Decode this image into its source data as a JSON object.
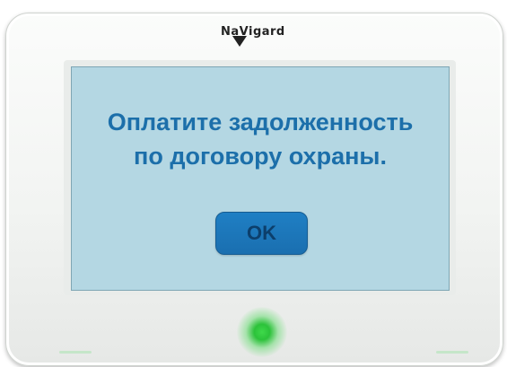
{
  "device": {
    "brand_logo": "NaVigard"
  },
  "dialog": {
    "message_line1": "Оплатите задолженность",
    "message_line2": "по договору охраны.",
    "ok_label": "OK"
  },
  "colors": {
    "screen_background": "#b4d7e3",
    "message_text": "#1c6faa",
    "button_fill": "#1f7fc4",
    "button_text": "#0c3f6c",
    "status_led": "#3ed94a"
  },
  "icons": {
    "status_led": "status-led-icon",
    "logo_mark": "triangle-down-logo-icon"
  }
}
